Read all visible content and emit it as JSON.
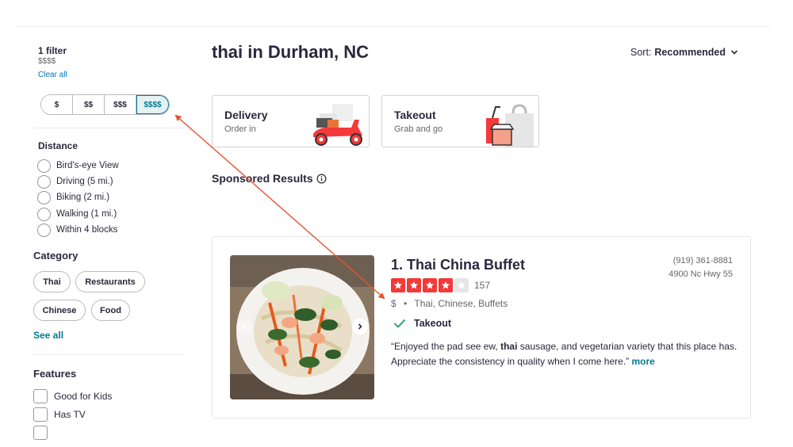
{
  "filters": {
    "count_label": "1 filter",
    "value_label": "$$$$",
    "clear_label": "Clear all",
    "price_options": [
      "$",
      "$$",
      "$$$",
      "$$$$"
    ],
    "price_selected": "$$$$"
  },
  "distance": {
    "title": "Distance",
    "options": [
      "Bird's-eye View",
      "Driving (5 mi.)",
      "Biking (2 mi.)",
      "Walking (1 mi.)",
      "Within 4 blocks"
    ]
  },
  "category": {
    "title": "Category",
    "chips": [
      "Thai",
      "Restaurants",
      "Chinese",
      "Food"
    ],
    "see_all": "See all"
  },
  "features": {
    "title": "Features",
    "options": [
      "Good for Kids",
      "Has TV"
    ]
  },
  "header": {
    "title": "thai in Durham, NC",
    "sort_prefix": "Sort:",
    "sort_value": "Recommended"
  },
  "services": [
    {
      "title": "Delivery",
      "subtitle": "Order in"
    },
    {
      "title": "Takeout",
      "subtitle": "Grab and go"
    }
  ],
  "sponsored_label": "Sponsored Results",
  "result": {
    "name": "1. Thai China Buffet",
    "rating": 4,
    "review_count": "157",
    "price": "$",
    "categories": "Thai, Chinese, Buffets",
    "takeout_label": "Takeout",
    "phone": "(919) 361-8881",
    "address": "4900 Nc Hwy 55",
    "snippet_before": "“Enjoyed the pad see ew, ",
    "snippet_bold": "thai",
    "snippet_after": " sausage, and vegetarian variety that this place has. Appreciate the consistency in quality when I come here.”",
    "more_label": "more"
  },
  "colors": {
    "accent_teal": "#027a97",
    "star_red": "#f43939",
    "star_empty": "#e6e6e6",
    "check_green": "#1a9b6b",
    "annotation_arrow": "#e8542f"
  }
}
